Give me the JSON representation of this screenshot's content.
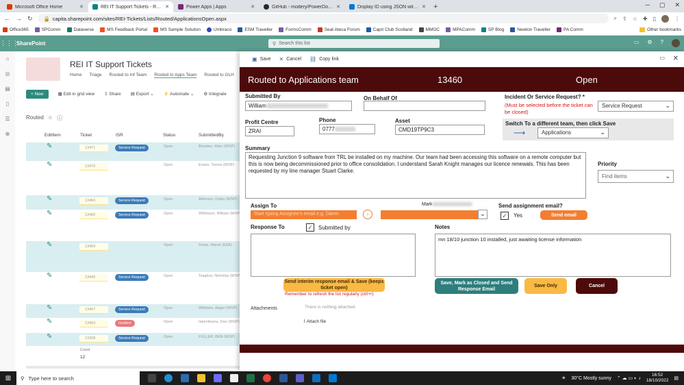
{
  "browser": {
    "tabs": [
      {
        "label": "Microsoft Office Home",
        "color": "#d83b01",
        "active": false
      },
      {
        "label": "REI IT Support Tickets - Routed",
        "color": "#038387",
        "active": true
      },
      {
        "label": "Power Apps | Apps",
        "color": "#742774",
        "active": false
      },
      {
        "label": "GitHub - modery/PowerDocu: Ge",
        "color": "#24292e",
        "active": false
      },
      {
        "label": "Display ID using JSON within a li",
        "color": "#0078d4",
        "active": false
      }
    ],
    "url": "capita.sharepoint.com/sites/REI-Tickets/Lists/Routed/ApplicationsOpen.aspx",
    "bookmarks": [
      "Office365",
      "SPComm",
      "Dataverse",
      "MS Feedback Portal",
      "MS Sample Solution",
      "Umbraco",
      "ESM Traveller",
      "FormsComm",
      "Seat Ateca Forum",
      "Capri Club Scotland",
      "MMOC",
      "MPAComm",
      "SP Blog",
      "Newton Traveller",
      "PA Comm"
    ],
    "other_bookmarks": "Other bookmarks"
  },
  "sharepoint": {
    "app_name": "SharePoint",
    "search_placeholder": "Search this list",
    "site_title": "REI IT Support Tickets",
    "nav": [
      "Home",
      "Triage",
      "Routed to Inf Team",
      "Routed to Apps Team",
      "Routed to GLH"
    ],
    "commands": {
      "new": "New",
      "edit_grid": "Edit in grid view",
      "share": "Share",
      "export": "Export",
      "automate": "Automate",
      "integrate": "Integrate"
    },
    "view_name": "Routed",
    "columns": [
      "EditItem",
      "Ticket",
      "ISR",
      "Status",
      "SubmittedBy"
    ],
    "rows": [
      {
        "ticket": "13471",
        "isr": "Service Request",
        "status": "Open",
        "by": "Blunden, Marc (WSP)"
      },
      {
        "ticket": "13470",
        "isr": "",
        "status": "Open",
        "by": "Evans, Tomos (WSP)"
      },
      {
        "ticket": "13466",
        "isr": "Service Request",
        "status": "Open",
        "by": "Atkinson, Dylan (WSP)"
      },
      {
        "ticket": "13460",
        "isr": "Service Request",
        "status": "Open",
        "by": "Wilkinson, William (WSP)"
      },
      {
        "ticket": "13459",
        "isr": "",
        "status": "Open",
        "by": "Sroka, Marek (ESA)"
      },
      {
        "ticket": "13445",
        "isr": "Service Request",
        "status": "Open",
        "by": "Tsagkos, Nicholas (WSP)"
      },
      {
        "ticket": "13407",
        "isr": "Service Request",
        "status": "Open",
        "by": "Wiltshire, Adgar (WSP)"
      },
      {
        "ticket": "13403",
        "isr": "Incident",
        "status": "Open",
        "by": "Iatomiteanu, Dan (WSP)"
      },
      {
        "ticket": "13368",
        "isr": "Service Request",
        "status": "Open",
        "by": "FULLER, BEN (WSP)"
      }
    ],
    "count_label": "Count",
    "count_value": "12"
  },
  "panel": {
    "save": "Save",
    "cancel": "Cancel",
    "copy_link": "Copy link"
  },
  "form": {
    "title": "Routed to Applications team",
    "ticket_number": "13460",
    "state": "Open",
    "submitted_by_label": "Submitted By",
    "submitted_by_value": "William",
    "on_behalf_of_label": "On Behalf Of",
    "incident_label": "Incident Or Service Request? *",
    "incident_note": "(Must be selected before the ticket can be closed)",
    "incident_value": "Service Request",
    "profit_centre_label": "Profit Centre",
    "profit_centre_value": "ZRAI",
    "phone_label": "Phone",
    "phone_value": "0777",
    "asset_label": "Asset",
    "asset_value": "CMD19TP9C3",
    "switch_label": "Switch To a different team, then click Save",
    "switch_value": "Applications",
    "summary_label": "Summary",
    "summary_text": "Requesting Junction 9 software from TRL be installed on my machine. Our team had been accessing this software on a remote computer but this is now being decommissioned prior to office consolidation. I understand Sarah Knight manages our licence renewals. This has been requested by my line manager Stuart Clarke.",
    "priority_label": "Priority",
    "priority_placeholder": "Find items",
    "assign_to_label": "Assign To",
    "assign_placeholder": "Start typing Assignee's email e.g. Daren",
    "assignee_partial": "Mark",
    "send_assign_label": "Send assignment email?",
    "yes_label": "Yes",
    "send_email_btn": "Send email",
    "response_to_label": "Response To",
    "submitted_by_check_label": "Submitted by",
    "notes_label": "Notes",
    "notes_text": "mn 18/10 junction 10 installed, just awaiting license information",
    "interim_btn": "Send interim response email & Save (keeps ticket open)",
    "reminder": "Remember to refresh the list regularly (ctrl+r)",
    "close_btn": "Save, Mark as Closed and Send Response Email",
    "save_only_btn": "Save Only",
    "cancel_btn": "Cancel",
    "attachments_label": "Attachments",
    "nothing_attached": "There is nothing attached.",
    "attach_file": "Attach file"
  },
  "taskbar": {
    "search_placeholder": "Type here to search",
    "weather": "30°C  Mostly sunny",
    "time": "16:52",
    "date": "18/10/2022"
  },
  "colors": {
    "form_header": "#4d0a0a",
    "accent_orange": "#f47e30",
    "accent_yellow": "#f9b944",
    "accent_teal": "#2d7e7c",
    "sp_green": "#5b9d8f"
  }
}
